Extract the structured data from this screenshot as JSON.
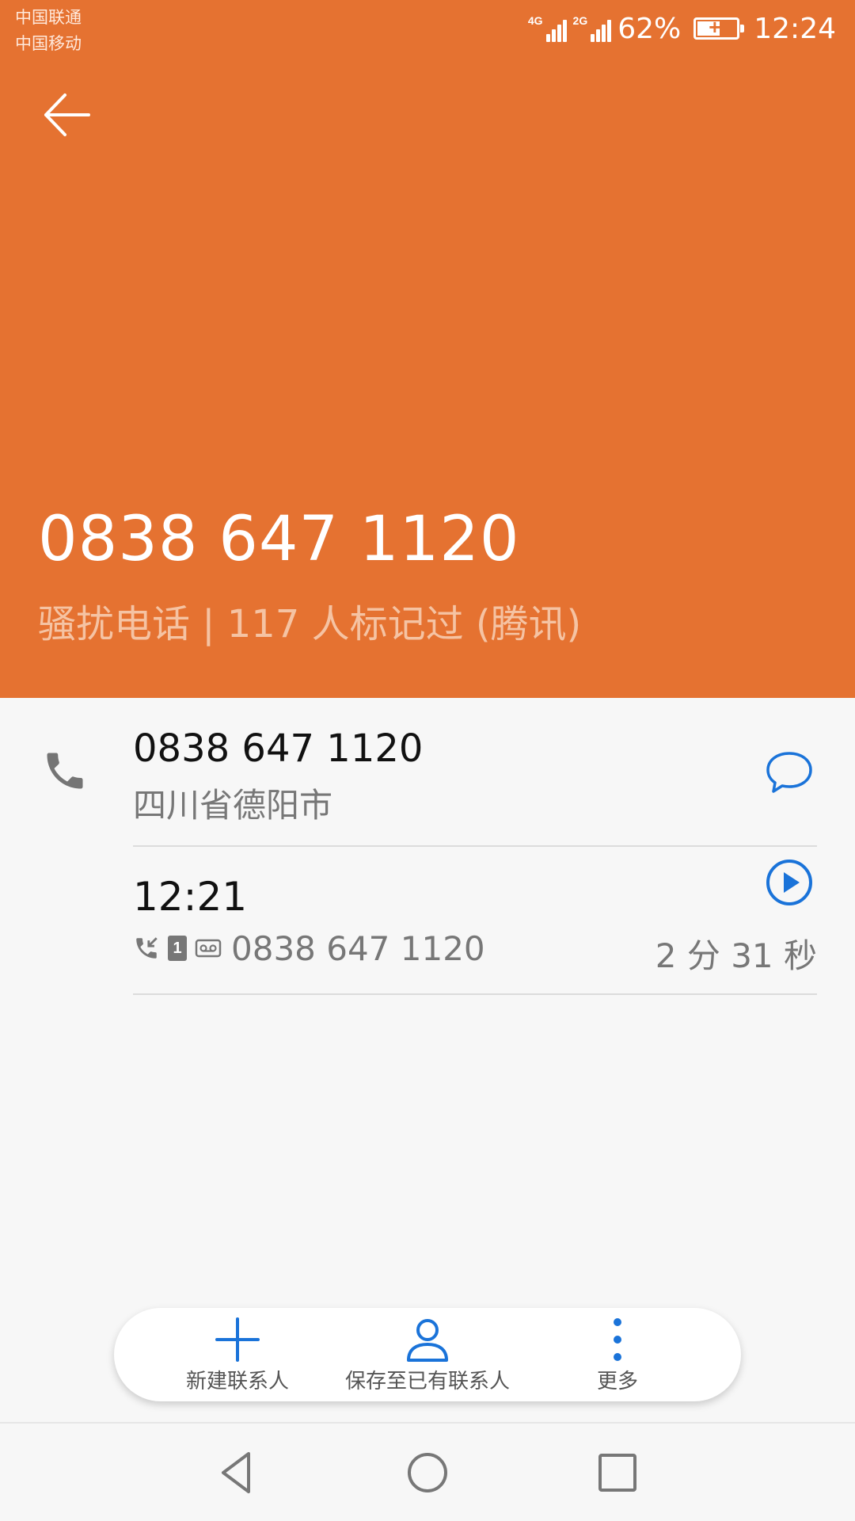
{
  "status_bar": {
    "carrier_1": "中国联通",
    "carrier_2": "中国移动",
    "network_1": "4G",
    "network_2": "2G",
    "battery_percent": "62%",
    "battery_level": 0.62,
    "time": "12:24"
  },
  "header": {
    "back_icon": "back-arrow-icon",
    "number": "0838 647 1120",
    "tag": "骚扰电话 | 117 人标记过 (腾讯)",
    "background_color": "#e57231"
  },
  "contact": {
    "number": "0838 647 1120",
    "location": "四川省德阳市",
    "phone_icon": "phone-icon",
    "message_icon": "message-bubble-icon"
  },
  "call_log": {
    "time": "12:21",
    "sim_slot": "1",
    "number": "0838 647 1120",
    "duration": "2 分 31 秒",
    "play_icon": "play-recording-icon"
  },
  "actions": [
    {
      "label": "新建联系人",
      "icon": "plus-icon"
    },
    {
      "label": "保存至已有联系人",
      "icon": "person-icon"
    },
    {
      "label": "更多",
      "icon": "more-vertical-icon"
    }
  ],
  "accent_color": "#1a73d9"
}
